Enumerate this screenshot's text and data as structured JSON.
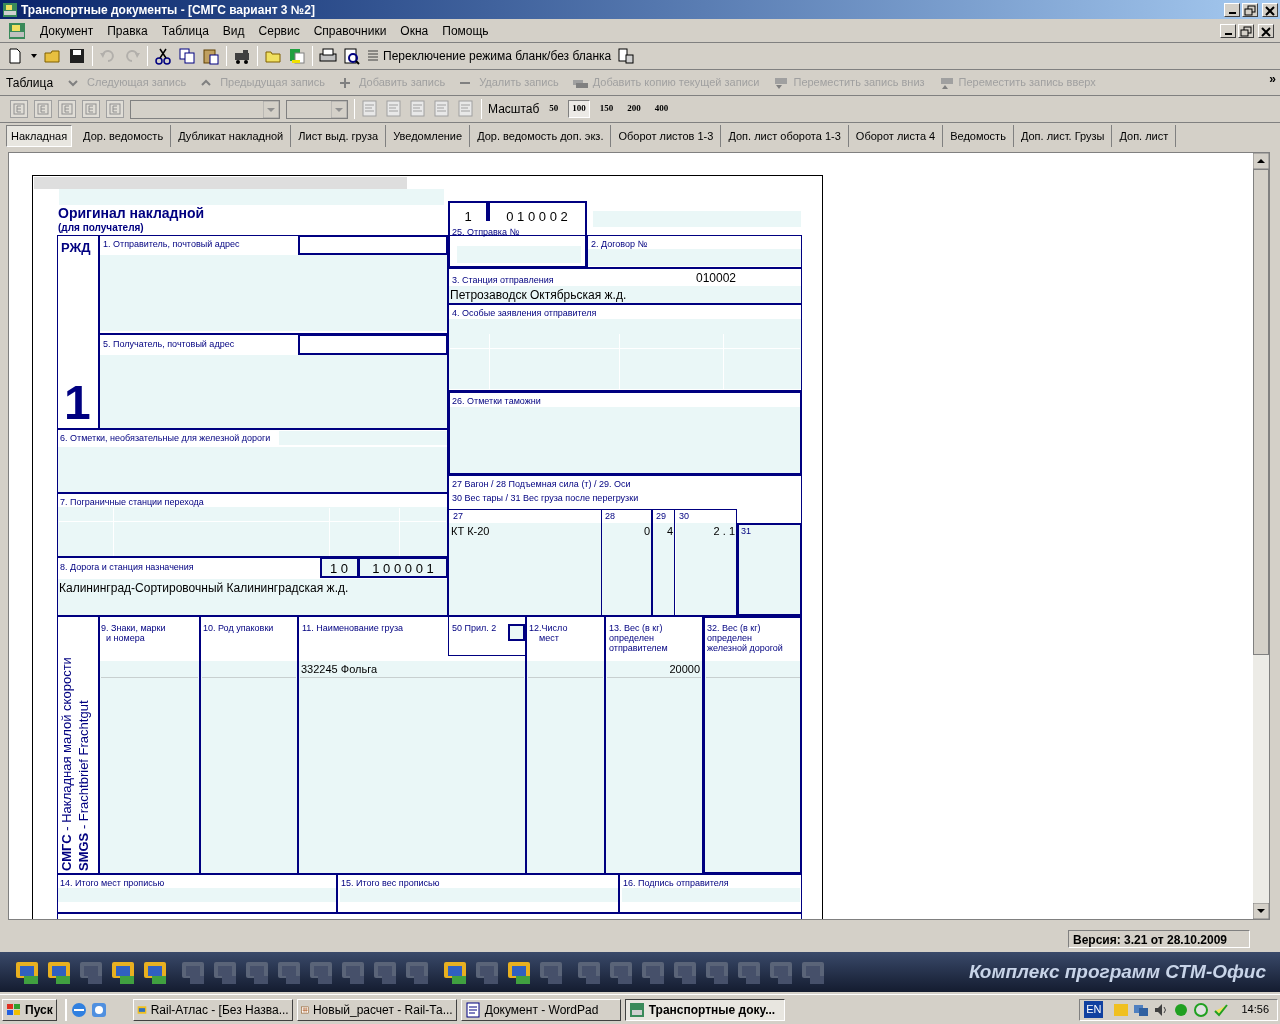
{
  "window": {
    "title": "Транспортные документы - [СМГС вариант 3 №2]"
  },
  "menu": [
    "Документ",
    "Правка",
    "Таблица",
    "Вид",
    "Сервис",
    "Справочники",
    "Окна",
    "Помощь"
  ],
  "toolbar": {
    "mode_toggle": "Переключение режима бланк/без бланка"
  },
  "table_toolbar": {
    "label": "Таблица",
    "actions": [
      {
        "label": "Следующая запись",
        "disabled": true
      },
      {
        "label": "Предыдущая запись",
        "disabled": true
      },
      {
        "label": "Добавить запись",
        "disabled": true
      },
      {
        "label": "Удалить запись",
        "disabled": true
      },
      {
        "label": "Добавить копию текущей записи",
        "disabled": true
      },
      {
        "label": "Переместить запись вниз",
        "disabled": true
      },
      {
        "label": "Переместить запись вверх",
        "disabled": true
      }
    ],
    "overflow": "»"
  },
  "format_toolbar": {
    "scale_label": "Масштаб",
    "scales": [
      {
        "label": "50",
        "selected": false
      },
      {
        "label": "100",
        "selected": true
      },
      {
        "label": "150",
        "selected": false
      },
      {
        "label": "200",
        "selected": false
      },
      {
        "label": "400",
        "selected": false
      }
    ]
  },
  "tabs": [
    {
      "label": "Накладная",
      "selected": true
    },
    {
      "label": "Дор. ведомость",
      "selected": false
    },
    {
      "label": "Дубликат накладной",
      "selected": false
    },
    {
      "label": "Лист выд. груза",
      "selected": false
    },
    {
      "label": "Уведомление",
      "selected": false
    },
    {
      "label": "Дор. ведомость доп. экз.",
      "selected": false
    },
    {
      "label": "Оборот листов 1-3",
      "selected": false
    },
    {
      "label": "Доп. лист оборота 1-3",
      "selected": false
    },
    {
      "label": "Оборот листа 4",
      "selected": false
    },
    {
      "label": "Ведомость",
      "selected": false
    },
    {
      "label": "Доп. лист. Грузы",
      "selected": false
    },
    {
      "label": "Доп. лист",
      "selected": false
    }
  ],
  "form": {
    "title": "Оригинал накладной",
    "subtitle": "(для получателя)",
    "railway": "РЖД",
    "sheet_number": "1",
    "dispatch_prefix": "1",
    "dispatch_number": "0 1 0 0 0 2",
    "side_lines": [
      "**СМГС** - Накладная малой скорости",
      "**SMGS** - Frachtbrief Frachtgut"
    ],
    "fields": [
      {
        "label": "1. Отправитель, почтовый адрес"
      },
      {
        "label": "25. Отправка №"
      },
      {
        "label": "2. Договор №"
      },
      {
        "label": "3. Станция отправления",
        "code": "010002",
        "value": "Петрозаводск Октябрьская ж.д."
      },
      {
        "label": "4. Особые заявления отправителя"
      },
      {
        "label": "5. Получатель, почтовый адрес"
      },
      {
        "label": "26. Отметки таможни"
      },
      {
        "label": "6. Отметки, необязательные для железной дороги"
      },
      {
        "label": "27 Вагон / 28 Подъемная сила (т) / 29. Оси"
      },
      {
        "label": "30 Вес тары / 31 Вес груза после перегрузки"
      },
      {
        "label": "7. Пограничные станции перехода"
      },
      {
        "label": "8. Дорога и станция назначения",
        "value": "Калининград-Сортировочный Калининградская ж.д."
      },
      {
        "label": "9. Знаки, марки\n  и номера"
      },
      {
        "label": "10. Род упаковки"
      },
      {
        "label": "11. Наименование груза",
        "value": "332245 Фольга"
      },
      {
        "label": "50 Прил. 2"
      },
      {
        "label": "12.Число\n    мест"
      },
      {
        "label": "13. Вес (в кг)\nопределен\nотправителем",
        "value": "20000"
      },
      {
        "label": "32. Вес (в кг)\nопределен\nжелезной дорогой"
      },
      {
        "label": "14. Итого мест прописью"
      },
      {
        "label": "15. Итого вес прописью"
      },
      {
        "label": "16. Подпись отправителя"
      }
    ],
    "destination_codes": [
      "1 0",
      "1 0 0 0 0 1"
    ],
    "wagon_columns": [
      "27",
      "28",
      "29",
      "30"
    ],
    "wagon_row": [
      "КТ К-20",
      "0",
      "4",
      "2 . 1"
    ],
    "box_31": "31",
    "attachment_2_checked": false
  },
  "status_bar": {
    "version": "Версия: 3.21 от 28.10.2009"
  },
  "app_bar": {
    "title": "Комплекс программ СТМ-Офис"
  },
  "taskbar": {
    "start": "Пуск",
    "tasks": [
      {
        "label": "Rail-Атлас - [Без Назва...",
        "selected": false
      },
      {
        "label": "Новый_расчет - Rail-Та...",
        "selected": false
      },
      {
        "label": "Документ - WordPad",
        "selected": false
      },
      {
        "label": "Транспортные доку...",
        "selected": true
      }
    ],
    "language": "EN",
    "clock": "14:56"
  }
}
